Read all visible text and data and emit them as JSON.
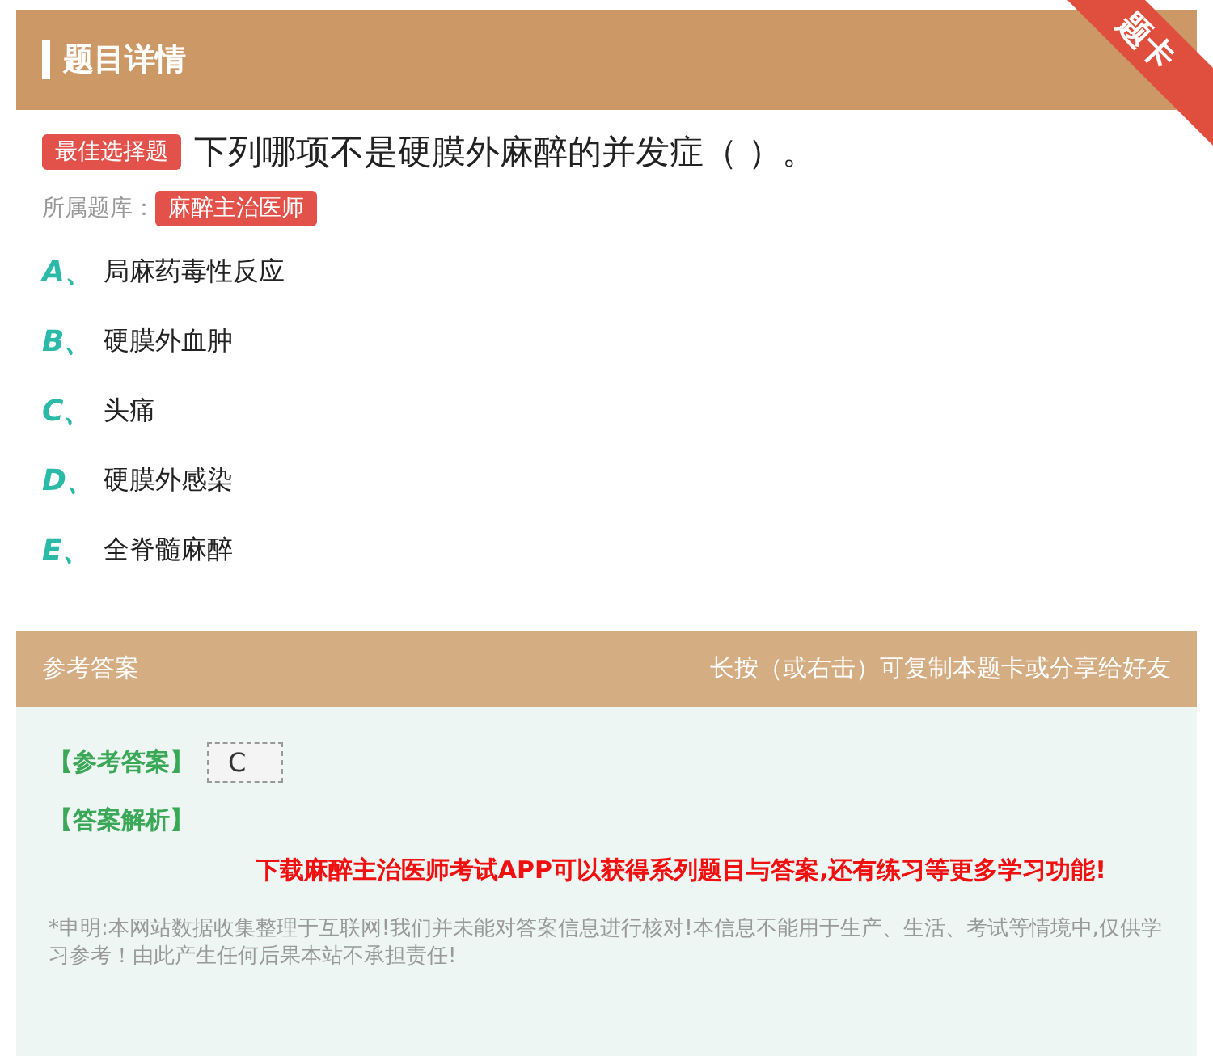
{
  "header": {
    "title": "题目详情",
    "ribbon": "题卡"
  },
  "question": {
    "type_badge": "最佳选择题",
    "text": "下列哪项不是硬膜外麻醉的并发症（ ）。",
    "bank_label": "所属题库：",
    "bank": "麻醉主治医师"
  },
  "options": [
    {
      "letter": "A、",
      "text": "局麻药毒性反应"
    },
    {
      "letter": "B、",
      "text": "硬膜外血肿"
    },
    {
      "letter": "C、",
      "text": "头痛"
    },
    {
      "letter": "D、",
      "text": "硬膜外感染"
    },
    {
      "letter": "E、",
      "text": "全脊髓麻醉"
    }
  ],
  "answer_section": {
    "title": "参考答案",
    "hint": "长按（或右击）可复制本题卡或分享给好友",
    "answer_label": "【参考答案】",
    "answer": "C",
    "analysis_label": "【答案解析】",
    "promo": "下载麻醉主治医师考试APP可以获得系列题目与答案,还有练习等更多学习功能!",
    "disclaimer": "*申明:本网站数据收集整理于互联网!我们并未能对答案信息进行核对!本信息不能用于生产、生活、考试等情境中,仅供学习参考！由此产生任何后果本站不承担责任!"
  }
}
